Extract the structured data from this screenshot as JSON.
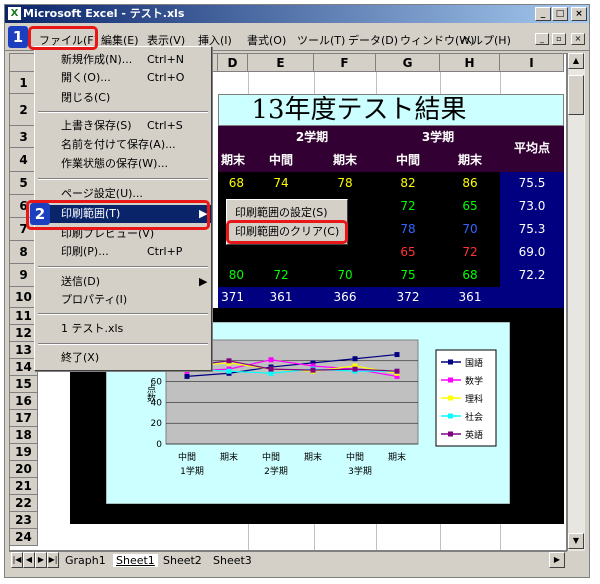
{
  "window": {
    "title": "Microsoft Excel - テスト.xls"
  },
  "menubar": {
    "items": [
      "ファイル(F)",
      "編集(E)",
      "表示(V)",
      "挿入(I)",
      "書式(O)",
      "ツール(T)",
      "データ(D)",
      "ウィンドウ(W)",
      "ヘルプ(H)"
    ]
  },
  "columns": [
    "D",
    "E",
    "F",
    "G",
    "H",
    "I"
  ],
  "rows": [
    "1",
    "2",
    "3",
    "4",
    "5",
    "6",
    "7",
    "8",
    "9",
    "10",
    "11",
    "12",
    "13",
    "14",
    "15",
    "16",
    "17",
    "18",
    "19",
    "20",
    "21",
    "22",
    "23",
    "24"
  ],
  "sheet": {
    "title": "13年度テスト結果",
    "term2": "2学期",
    "term3": "3学期",
    "midterm": "中間",
    "final": "期末",
    "final_partial": "期末",
    "average": "平均点",
    "row5": [
      "68",
      "74",
      "78",
      "82",
      "86",
      "75.5"
    ],
    "row6": [
      "72",
      "65",
      "73.0"
    ],
    "row7": [
      "78",
      "70",
      "75.3"
    ],
    "row8": [
      "65",
      "72",
      "69.0"
    ],
    "row9": [
      "80",
      "72",
      "70",
      "75",
      "68",
      "72.2"
    ],
    "row10": [
      "371",
      "361",
      "366",
      "372",
      "361"
    ]
  },
  "chart_data": {
    "type": "line",
    "categories": [
      "中間",
      "期末",
      "中間",
      "期末",
      "中間",
      "期末"
    ],
    "group_labels": [
      "1学期",
      "2学期",
      "3学期"
    ],
    "ylabel": "点数",
    "ylim": [
      0,
      100
    ],
    "yticks": [
      "80",
      "60",
      "40",
      "20",
      "0"
    ],
    "series": [
      {
        "name": "国語",
        "color": "#000080",
        "marker": "diamond",
        "values": [
          65,
          68,
          74,
          78,
          82,
          86
        ]
      },
      {
        "name": "数学",
        "color": "#ff00ff",
        "marker": "square",
        "values": [
          70,
          72,
          81,
          75,
          72,
          65
        ]
      },
      {
        "name": "理科",
        "color": "#ffff00",
        "marker": "triangle",
        "values": [
          75,
          78,
          72,
          70,
          75,
          68
        ]
      },
      {
        "name": "社会",
        "color": "#00ffff",
        "marker": "x",
        "values": [
          72,
          70,
          68,
          72,
          70,
          70
        ]
      },
      {
        "name": "英語",
        "color": "#800080",
        "marker": "star",
        "values": [
          75,
          80,
          72,
          71,
          72,
          70
        ]
      }
    ]
  },
  "file_menu": {
    "items": [
      {
        "label": "新規作成(N)...",
        "shortcut": "Ctrl+N"
      },
      {
        "label": "開く(O)...",
        "shortcut": "Ctrl+O"
      },
      {
        "label": "閉じる(C)",
        "shortcut": ""
      },
      {
        "label": "上書き保存(S)",
        "shortcut": "Ctrl+S"
      },
      {
        "label": "名前を付けて保存(A)...",
        "shortcut": ""
      },
      {
        "label": "作業状態の保存(W)...",
        "shortcut": ""
      },
      {
        "label": "ページ設定(U)...",
        "shortcut": ""
      },
      {
        "label": "印刷範囲(T)",
        "shortcut": ""
      },
      {
        "label": "印刷プレビュー(V)",
        "shortcut": ""
      },
      {
        "label": "印刷(P)...",
        "shortcut": "Ctrl+P"
      },
      {
        "label": "送信(D)",
        "shortcut": ""
      },
      {
        "label": "プロパティ(I)",
        "shortcut": ""
      },
      {
        "label": "1 テスト.xls",
        "shortcut": ""
      },
      {
        "label": "終了(X)",
        "shortcut": ""
      }
    ]
  },
  "submenu": {
    "items": [
      "印刷範囲の設定(S)",
      "印刷範囲のクリア(C)"
    ]
  },
  "badges": [
    "1",
    "2"
  ],
  "tabs": [
    "Graph1",
    "Sheet1",
    "Sheet2",
    "Sheet3"
  ]
}
